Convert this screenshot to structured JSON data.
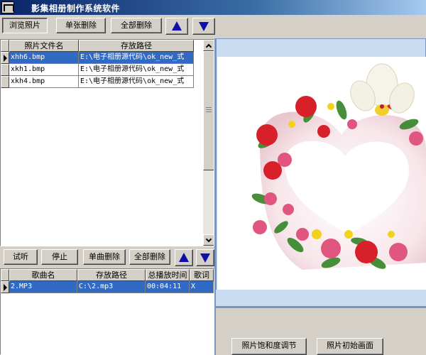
{
  "window": {
    "title": "影集相册制作系统软件"
  },
  "photo_toolbar": {
    "browse_label": "浏览照片",
    "delete_one_label": "单张删除",
    "delete_all_label": "全部删除"
  },
  "photo_grid": {
    "columns": [
      "照片文件名",
      "存放路径"
    ],
    "rows": [
      {
        "name": "xhh6.bmp",
        "path": "E:\\电子相册源代码\\ok_new_式",
        "selected": true
      },
      {
        "name": "xkh1.bmp",
        "path": "E:\\电子相册源代码\\ok_new_式",
        "selected": false
      },
      {
        "name": "xkh4.bmp",
        "path": "E:\\电子相册源代码\\ok_new_式",
        "selected": false
      }
    ]
  },
  "music_toolbar": {
    "try_label": "试听",
    "stop_label": "停止",
    "delete_one_label": "单曲删除",
    "delete_all_label": "全部删除"
  },
  "music_grid": {
    "columns": [
      "歌曲名",
      "存放路径",
      "总播放时间",
      "歌词"
    ],
    "rows": [
      {
        "song": "2.MP3",
        "path": "C:\\2.mp3",
        "duration": "00:04:11",
        "lyrics": "X",
        "selected": true
      }
    ]
  },
  "bottom_panel": {
    "saturation_label": "照片饱和度调节",
    "initial_label": "照片初始画面"
  },
  "colors": {
    "titlebar_start": "#0a246a",
    "selection": "#316ac5",
    "arrow": "#1010a8",
    "preview_border": "#7a96c0"
  }
}
